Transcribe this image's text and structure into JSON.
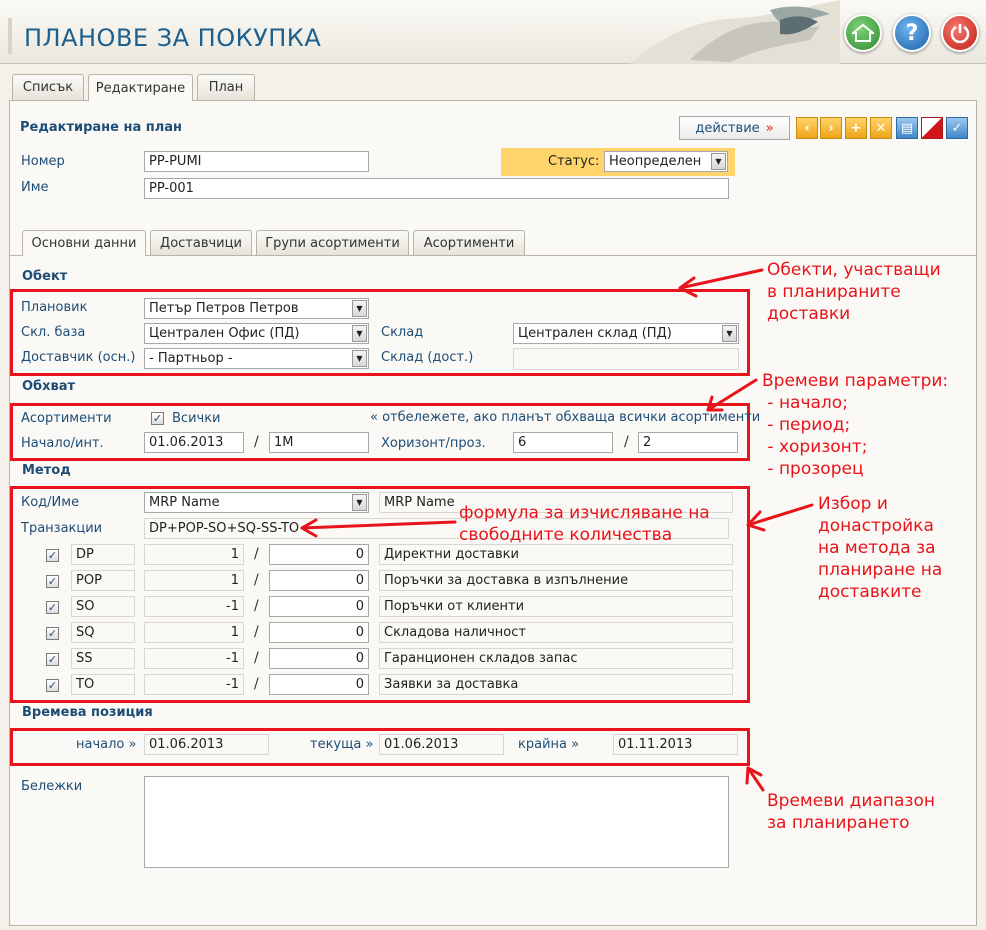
{
  "header": {
    "title": "ПЛАНОВЕ ЗА ПОКУПКА",
    "home_icon": "home-icon",
    "help_icon": "help-icon",
    "power_icon": "power-icon"
  },
  "tabs": [
    {
      "label": "Списък"
    },
    {
      "label": "Редактиране"
    },
    {
      "label": "План"
    }
  ],
  "form": {
    "title": "Редактиране на план",
    "action_label": "действие",
    "action_mark": "»",
    "toolbar_icons": [
      "prev-icon",
      "next-icon",
      "add-icon",
      "delete-icon",
      "print-icon",
      "cancel-icon",
      "save-icon"
    ],
    "number_label": "Номер",
    "number_value": "PP-PUMI",
    "name_label": "Име",
    "name_value": "PP-001",
    "status_label": "Статус:",
    "status_value": "Неопределен"
  },
  "subtabs": [
    {
      "label": "Основни данни"
    },
    {
      "label": "Доставчици"
    },
    {
      "label": "Групи асортименти"
    },
    {
      "label": "Асортименти"
    }
  ],
  "object": {
    "title": "Обект",
    "planner_label": "Плановик",
    "planner_value": "Петър Петров Петров",
    "base_label": "Скл. база",
    "base_value": "Централен Офис (ПД)",
    "supplier_label": "Доставчик (осн.)",
    "supplier_value": "- Партньор -",
    "warehouse_label": "Склад",
    "warehouse_value": "Централен склад (ПД)",
    "warehouse_supply_label": "Склад (дост.)",
    "warehouse_supply_value": ""
  },
  "scope": {
    "title": "Обхват",
    "assortments_label": "Асортименти",
    "all_label": "Всички",
    "all_checked": true,
    "hint": "« отбележете, ако планът обхваща всички асортименти",
    "start_label": "Начало/инт.",
    "start_value": "01.06.2013",
    "interval_value": "1M",
    "horizon_label": "Хоризонт/проз.",
    "horizon_value": "6",
    "window_value": "2"
  },
  "method": {
    "title": "Метод",
    "code_label": "Код/Име",
    "code_value": "MRP Name",
    "name_value": "MRP Name",
    "transactions_label": "Транзакции",
    "formula": "DP+POP-SO+SQ-SS-TO",
    "rows": [
      {
        "checked": true,
        "code": "DP",
        "factor": "1",
        "offset": "0",
        "description": "Директни доставки"
      },
      {
        "checked": true,
        "code": "POP",
        "factor": "1",
        "offset": "0",
        "description": "Поръчки за доставка в изпълнение"
      },
      {
        "checked": true,
        "code": "SO",
        "factor": "-1",
        "offset": "0",
        "description": "Поръчки от клиенти"
      },
      {
        "checked": true,
        "code": "SQ",
        "factor": "1",
        "offset": "0",
        "description": "Складова наличност"
      },
      {
        "checked": true,
        "code": "SS",
        "factor": "-1",
        "offset": "0",
        "description": "Гаранционен складов запас"
      },
      {
        "checked": true,
        "code": "TO",
        "factor": "-1",
        "offset": "0",
        "description": "Заявки за доставка"
      }
    ]
  },
  "time_position": {
    "title": "Времева позиция",
    "start_label": "начало »",
    "start_value": "01.06.2013",
    "current_label": "текуща »",
    "current_value": "01.06.2013",
    "end_label": "крайна »",
    "end_value": "01.11.2013"
  },
  "notes": {
    "label": "Бележки",
    "value": ""
  },
  "annotations": {
    "objects": [
      "Обекти, участващи",
      "в планираните",
      "доставки"
    ],
    "time_params": [
      "Времеви параметри:",
      " - начало;",
      " - период;",
      " - хоризонт;",
      " - прозорец"
    ],
    "formula": [
      "формула за изчисляване на",
      "свободните количества"
    ],
    "method": [
      "Избор и",
      "донастройка",
      "на метода за",
      "планиране на",
      "доставките"
    ],
    "range": [
      "Времеви диапазон",
      "за планирането"
    ]
  },
  "colors": {
    "accent": "#1d5f8d",
    "annotation": "#e8141b",
    "status_bg": "#ffd56b",
    "toolbar": "#f0a416"
  }
}
